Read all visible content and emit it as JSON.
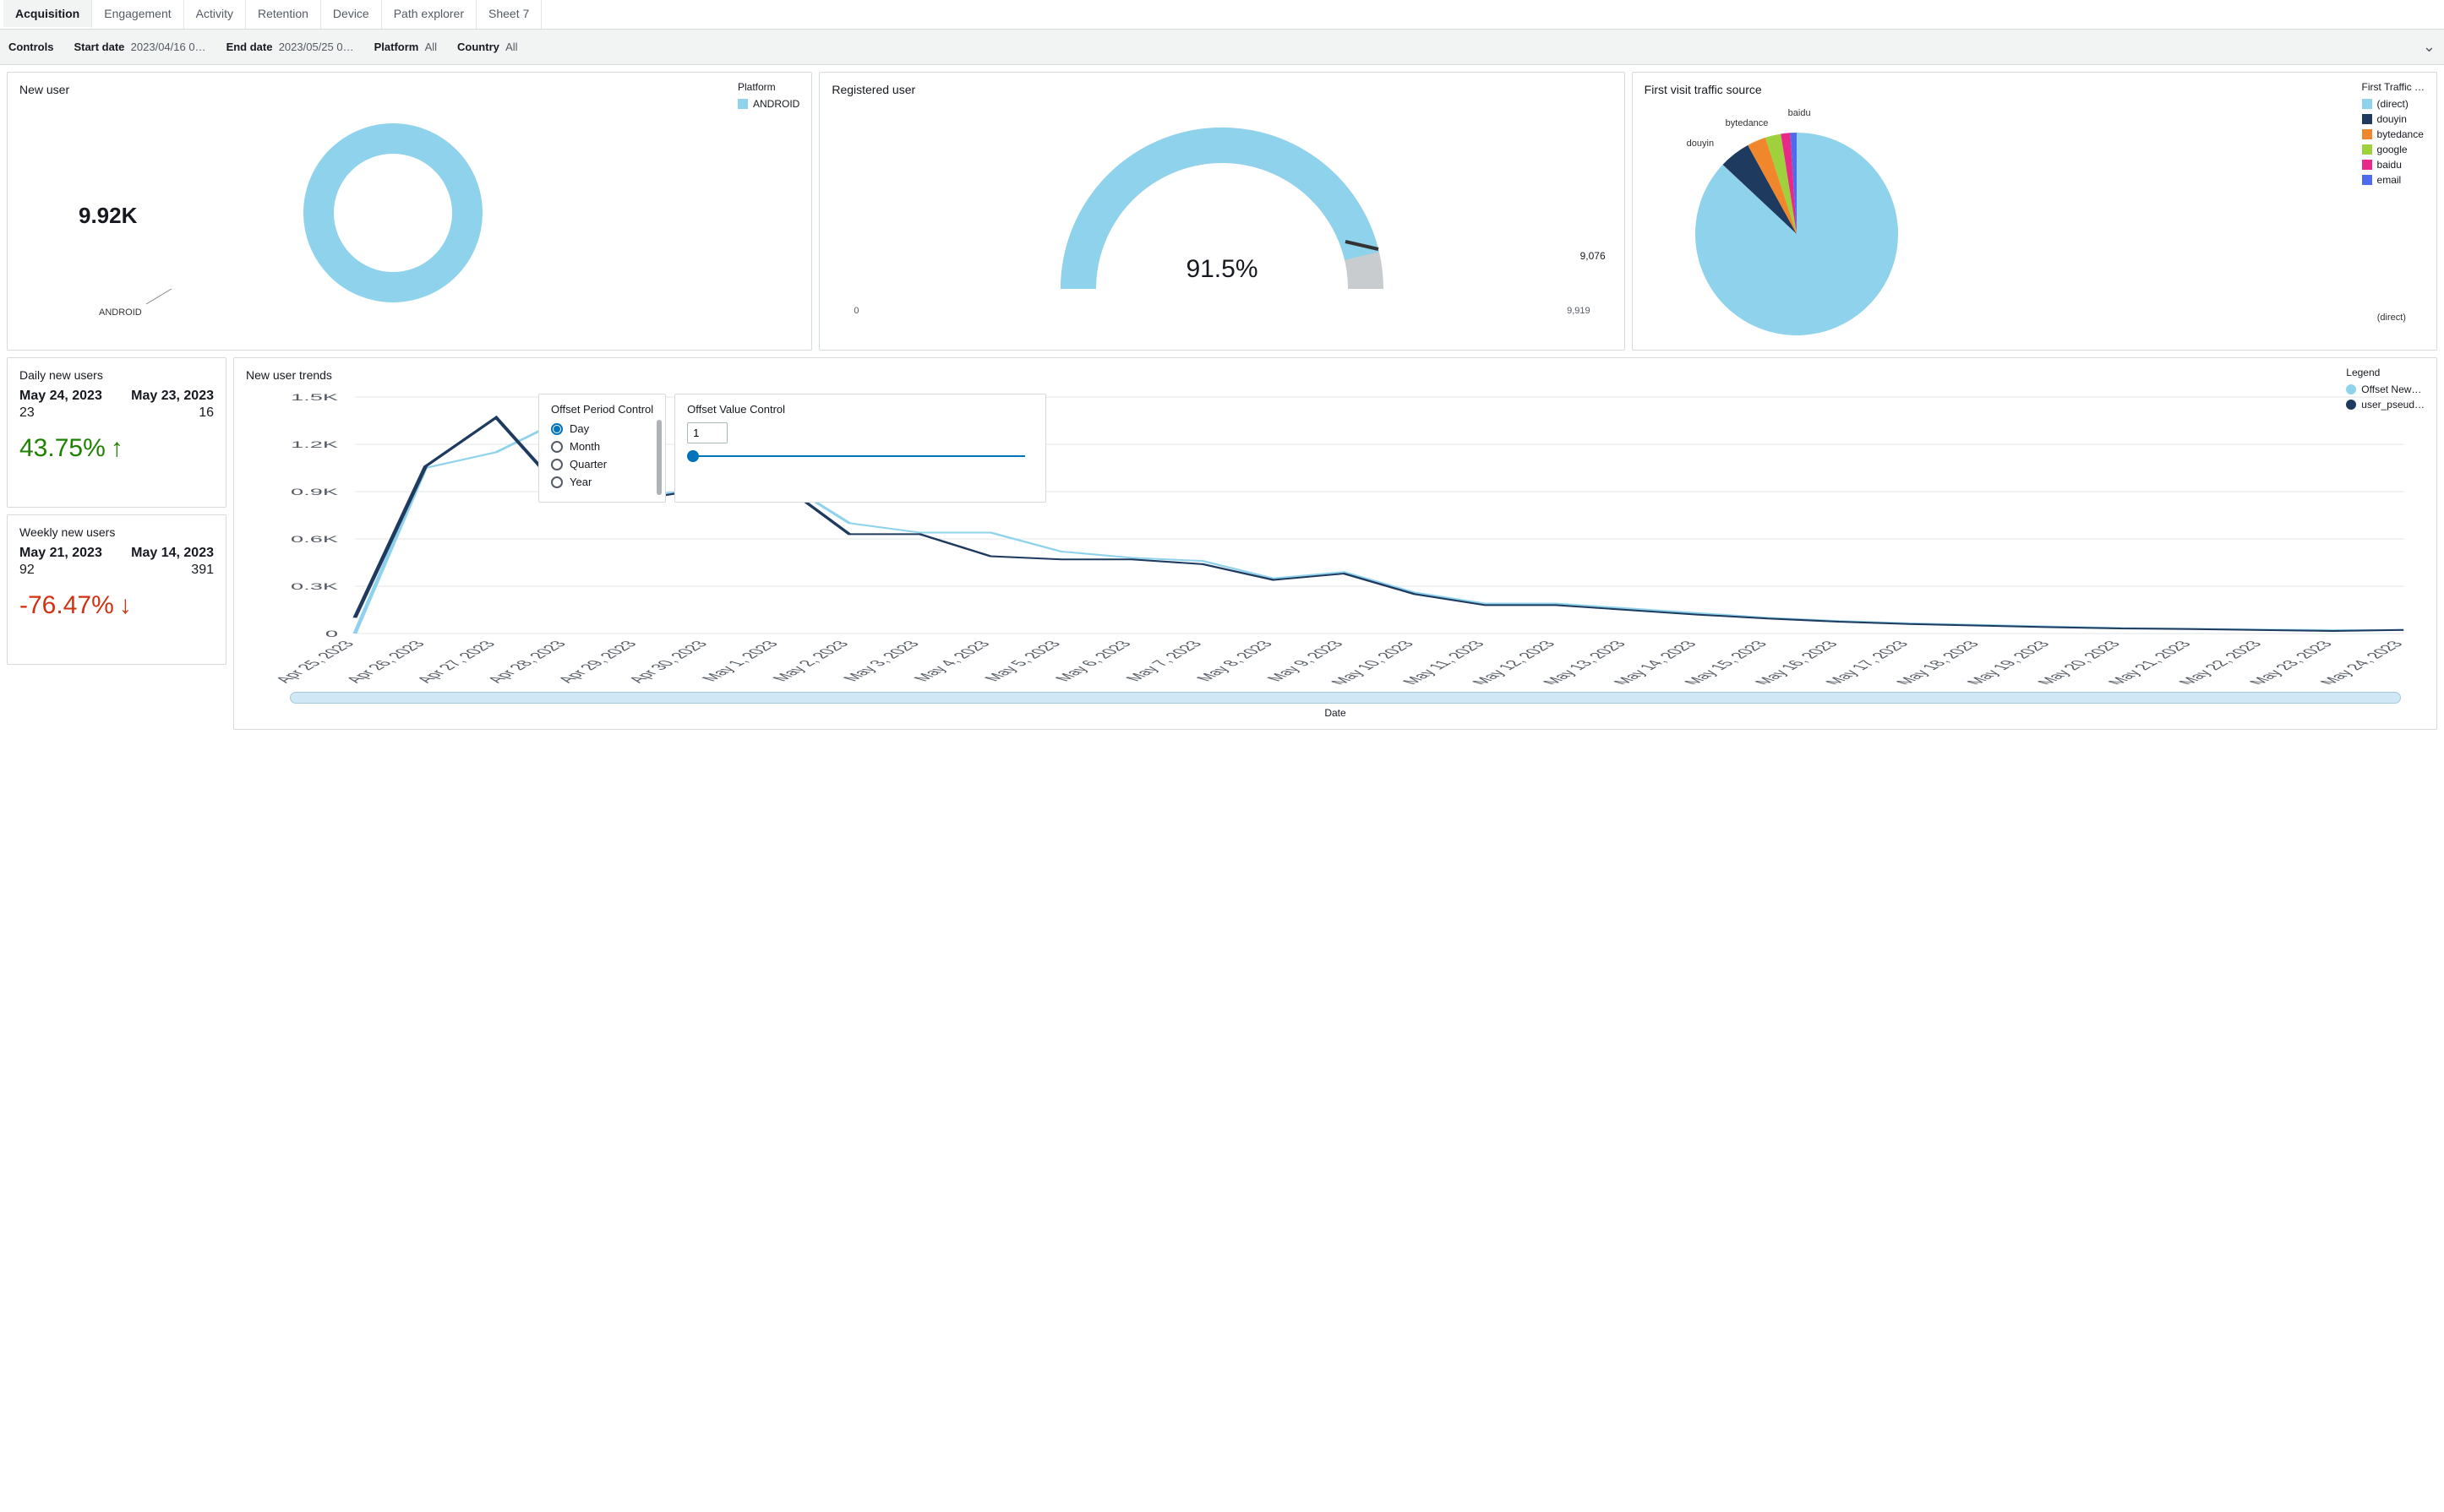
{
  "tabs": [
    "Acquisition",
    "Engagement",
    "Activity",
    "Retention",
    "Device",
    "Path explorer",
    "Sheet 7"
  ],
  "active_tab": 0,
  "controls": {
    "label": "Controls",
    "start_date_label": "Start date",
    "start_date_value": "2023/04/16 0…",
    "end_date_label": "End date",
    "end_date_value": "2023/05/25 0…",
    "platform_label": "Platform",
    "platform_value": "All",
    "country_label": "Country",
    "country_value": "All"
  },
  "new_user": {
    "title": "New user",
    "legend_title": "Platform",
    "legend_item": "ANDROID",
    "center_value": "9.92K",
    "slice_label": "ANDROID"
  },
  "registered_user": {
    "title": "Registered user",
    "center_value": "91.5%",
    "min_label": "0",
    "current_value": "9,076",
    "max_label": "9,919"
  },
  "traffic": {
    "title": "First visit traffic source",
    "legend_title": "First Traffic …",
    "labels": {
      "douyin": "douyin",
      "bytedance": "bytedance",
      "baidu": "baidu",
      "direct": "(direct)"
    }
  },
  "daily": {
    "title": "Daily new users",
    "date_a": "May 24, 2023",
    "date_b": "May 23, 2023",
    "val_a": "23",
    "val_b": "16",
    "delta": "43.75%",
    "arrow": "↑"
  },
  "weekly": {
    "title": "Weekly new users",
    "date_a": "May 21, 2023",
    "date_b": "May 14, 2023",
    "val_a": "92",
    "val_b": "391",
    "delta": "-76.47%",
    "arrow": "↓"
  },
  "trends": {
    "title": "New user trends",
    "legend_title": "Legend",
    "legend_items": [
      "Offset New…",
      "user_pseud…"
    ],
    "offset_period_title": "Offset Period Control",
    "period_options": [
      "Day",
      "Month",
      "Quarter",
      "Year"
    ],
    "period_selected": "Day",
    "offset_value_title": "Offset Value Control",
    "offset_value": "1",
    "xlabel": "Date"
  },
  "chart_data": [
    {
      "id": "new_user_donut",
      "type": "pie",
      "title": "New user",
      "series": [
        {
          "name": "ANDROID",
          "value": 9920,
          "color": "#8fd2ec"
        }
      ],
      "center_label": "9.92K"
    },
    {
      "id": "registered_user_gauge",
      "type": "gauge",
      "title": "Registered user",
      "value": 9076,
      "max": 9919,
      "percent": 91.5,
      "color_fill": "#8fd2ec",
      "color_rest": "#c9ccce"
    },
    {
      "id": "traffic_source_pie",
      "type": "pie",
      "title": "First visit traffic source",
      "legend_title": "First Traffic …",
      "series": [
        {
          "name": "(direct)",
          "value": 87,
          "color": "#8fd2ec"
        },
        {
          "name": "douyin",
          "value": 5,
          "color": "#1f3a5f"
        },
        {
          "name": "bytedance",
          "value": 3,
          "color": "#f0872d"
        },
        {
          "name": "google",
          "value": 2.5,
          "color": "#9fd13c"
        },
        {
          "name": "baidu",
          "value": 1.5,
          "color": "#e7298a"
        },
        {
          "name": "email",
          "value": 1,
          "color": "#4f6bed"
        }
      ]
    },
    {
      "id": "new_user_trends",
      "type": "line",
      "title": "New user trends",
      "xlabel": "Date",
      "ylabel": "",
      "ylim": [
        0,
        1500
      ],
      "y_ticks": [
        "0",
        "0.3K",
        "0.6K",
        "0.9K",
        "1.2K",
        "1.5K"
      ],
      "categories": [
        "Apr 25, 2023",
        "Apr 26, 2023",
        "Apr 27, 2023",
        "Apr 28, 2023",
        "Apr 29, 2023",
        "Apr 30, 2023",
        "May 1, 2023",
        "May 2, 2023",
        "May 3, 2023",
        "May 4, 2023",
        "May 5, 2023",
        "May 6, 2023",
        "May 7, 2023",
        "May 8, 2023",
        "May 9, 2023",
        "May 10, 2023",
        "May 11, 2023",
        "May 12, 2023",
        "May 13, 2023",
        "May 14, 2023",
        "May 15, 2023",
        "May 16, 2023",
        "May 17, 2023",
        "May 18, 2023",
        "May 19, 2023",
        "May 20, 2023",
        "May 21, 2023",
        "May 22, 2023",
        "May 23, 2023",
        "May 24, 2023"
      ],
      "series": [
        {
          "name": "Offset New…",
          "color": "#8fd2ec",
          "values": [
            0,
            1050,
            1150,
            1370,
            870,
            920,
            980,
            700,
            640,
            640,
            520,
            480,
            460,
            350,
            390,
            260,
            190,
            190,
            160,
            130,
            100,
            80,
            65,
            55,
            45,
            35,
            30,
            25,
            22,
            23
          ]
        },
        {
          "name": "user_pseud…",
          "color": "#1f3a5f",
          "values": [
            100,
            1060,
            1370,
            870,
            850,
            920,
            960,
            630,
            630,
            490,
            470,
            470,
            440,
            340,
            380,
            250,
            180,
            180,
            150,
            120,
            95,
            75,
            60,
            50,
            40,
            32,
            28,
            22,
            16,
            23
          ]
        }
      ]
    }
  ]
}
